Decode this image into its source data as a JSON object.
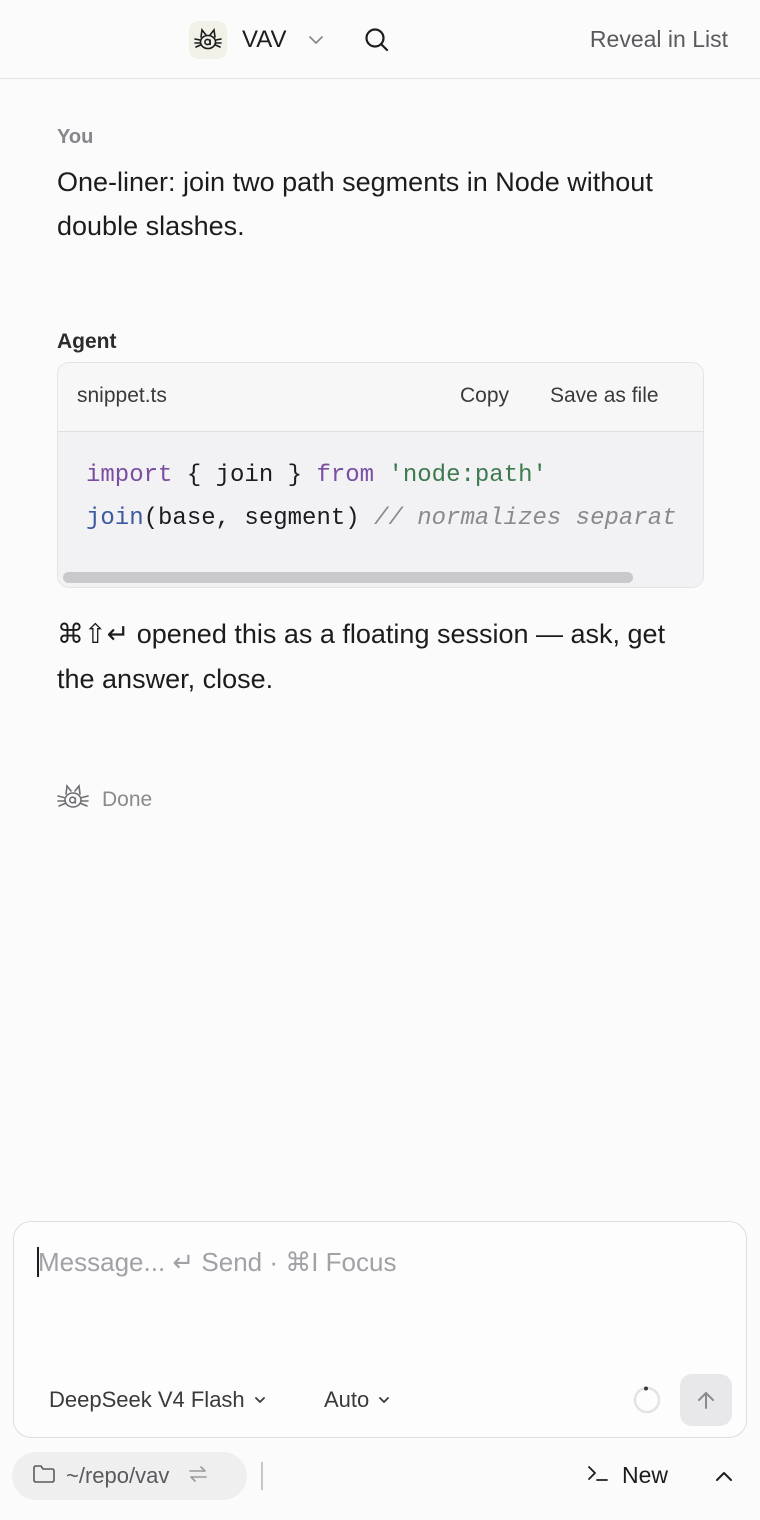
{
  "header": {
    "app_name": "VAV",
    "reveal_label": "Reveal in List",
    "icons": [
      "vav-logo-icon",
      "chevron-down-icon",
      "search-icon"
    ]
  },
  "conversation": {
    "user": {
      "label": "You",
      "text": "One-liner: join two path segments in Node without double slashes."
    },
    "agent": {
      "label": "Agent",
      "snippet": {
        "filename": "snippet.ts",
        "copy_label": "Copy",
        "save_label": "Save as file",
        "line1": {
          "kw_import": "import",
          "brace_part": " { join } ",
          "kw_from": "from",
          "space": " ",
          "module": "'node:path'"
        },
        "line2": {
          "fn": "join",
          "args": "(base, segment) ",
          "comment": "// normalizes separat"
        }
      },
      "text": "⌘⇧↵ opened this as a floating session — ask, get the answer, close."
    },
    "status": {
      "label": "Done",
      "icon": "vav-logo-icon"
    }
  },
  "composer": {
    "placeholder": "Message...  ↵ Send · ⌘I Focus",
    "model": "DeepSeek V4 Flash",
    "mode": "Auto",
    "send_icon": "arrow-up-icon"
  },
  "footer": {
    "repo_path": "~/repo/vav",
    "new_label": "New",
    "icons": [
      "folder-icon",
      "swap-icon",
      "terminal-icon",
      "chevron-up-icon"
    ]
  },
  "colors": {
    "background": "#fbfbfb",
    "keyword": "#7a4ea3",
    "string": "#3d7b4f",
    "function": "#3c5aa0",
    "comment": "#8a8a8e"
  }
}
